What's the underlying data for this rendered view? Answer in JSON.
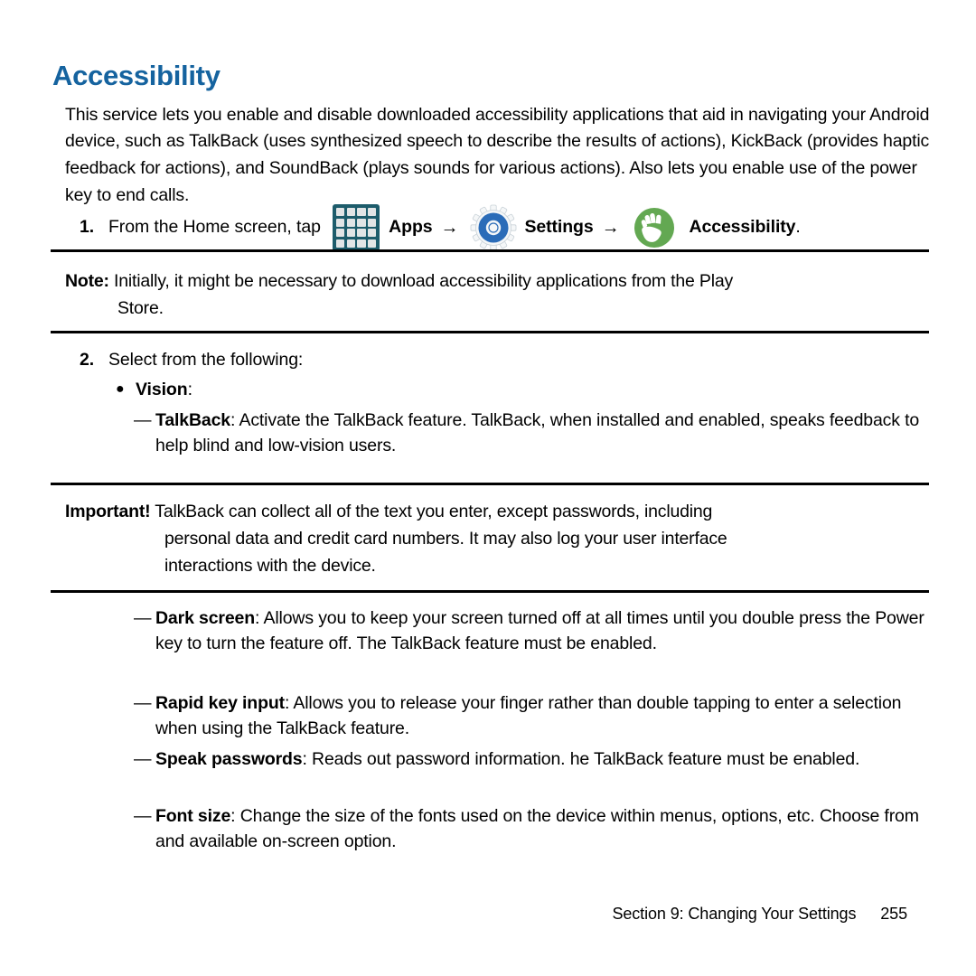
{
  "document": {
    "title": "Accessibility",
    "title_color": "#15639f",
    "intro_paragraph": "This service lets you enable and disable downloaded accessibility applications that aid in navigating your Android device, such as TalkBack (uses synthesized speech to describe the results of actions), KickBack (provides haptic feedback for actions), and SoundBack (plays sounds for various actions). Also lets you enable use of the power key to end calls."
  },
  "steps": [
    {
      "number": "1.",
      "text_before": "From the Home screen, tap ",
      "apps_label": "Apps",
      "arrow": "→",
      "settings_label": "Settings",
      "accessibility_label": "Accessibility",
      "trailing": "."
    },
    {
      "number": "2.",
      "text": "Select from the following:"
    }
  ],
  "icons": {
    "apps": {
      "name": "apps-grid-icon",
      "background": "#1d5c6b",
      "cell_color": "#e2e5e6",
      "rows": 4,
      "cols": 4
    },
    "settings": {
      "name": "settings-gear-icon",
      "color": "#2b6cb8",
      "ring_color": "#f2f4f6"
    },
    "accessibility": {
      "name": "accessibility-hand-icon",
      "color": "#63a852",
      "hand_color": "#ffffff"
    }
  },
  "note": {
    "lead": "Note:",
    "line1": "Initially, it might be necessary to download accessibility applications from the Play",
    "line2": "Store."
  },
  "important": {
    "lead": "Important!",
    "line1": "TalkBack can collect all of the text you enter, except passwords, including",
    "line2": "personal data and credit card numbers. It may also log your user interface",
    "line3": "interactions with the device."
  },
  "vision_bullet": {
    "marker": "●",
    "term": "Vision",
    "suffix": ":"
  },
  "dash_items": [
    {
      "marker": "—",
      "term": "TalkBack",
      "body": ": Activate the TalkBack feature. TalkBack, when installed and enabled, speaks feedback to help blind and low-vision users."
    },
    {
      "marker": "—",
      "term": "Dark screen",
      "body": ": Allows you to keep your screen turned off at all times until you double press the Power key to turn the feature off. The TalkBack feature must be enabled."
    },
    {
      "marker": "—",
      "term": "Rapid key input",
      "body": ": Allows you to release your finger rather than double tapping to enter a selection when using the TalkBack feature."
    },
    {
      "marker": "—",
      "term": "Speak passwords",
      "body": ": Reads out password information. he TalkBack feature must be enabled."
    },
    {
      "marker": "—",
      "term": "Font size",
      "body": ": Change the size of the fonts used on the device within menus, options, etc. Choose from and available on-screen option."
    }
  ],
  "footer": {
    "section": "Section 9:  Changing Your Settings",
    "page_number": "255"
  }
}
